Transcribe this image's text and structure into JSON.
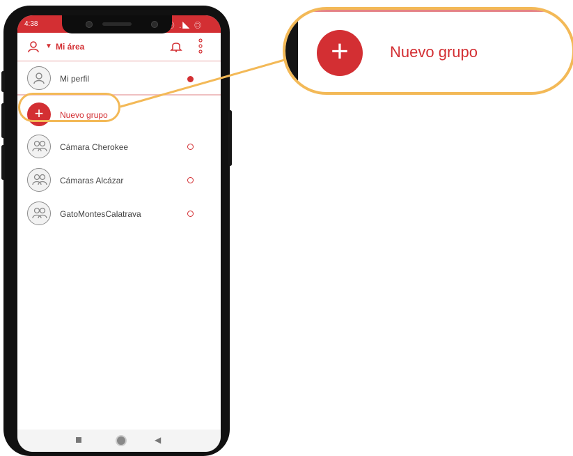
{
  "statusbar": {
    "time": "4:38",
    "icons": "⦿ .◣ ◎"
  },
  "appbar": {
    "title": "Mi área",
    "arrow": "▼",
    "user_icon": "user-icon",
    "bell_icon": "bell-icon",
    "more_icon": "more-vertical-icon"
  },
  "list": {
    "profile": {
      "label": "Mi perfil",
      "status": "filled"
    },
    "new_group": {
      "label": "Nuevo grupo",
      "plus": "+"
    },
    "groups": [
      {
        "label": "Cámara Cherokee",
        "status": "empty"
      },
      {
        "label": "Cámaras Alcázar",
        "status": "empty"
      },
      {
        "label": "GatoMontesCalatrava",
        "status": "empty"
      }
    ]
  },
  "callout": {
    "label": "Nuevo grupo",
    "plus": "+"
  },
  "navbar": {
    "back": "◀"
  },
  "colors": {
    "accent": "#d32f33",
    "highlight": "#f3b957"
  }
}
